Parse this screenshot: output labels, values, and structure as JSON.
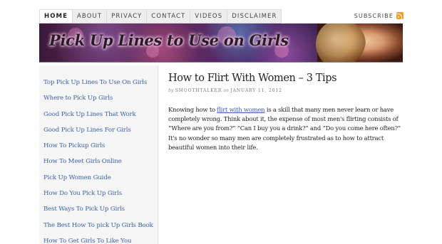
{
  "nav": {
    "items": [
      "HOME",
      "ABOUT",
      "PRIVACY",
      "CONTACT",
      "VIDEOS",
      "DISCLAIMER"
    ],
    "subscribe_label": "SUBSCRIBE"
  },
  "banner": {
    "title": "Pick Up Lines to Use on Girls"
  },
  "sidebar": {
    "links": [
      "Top Pick Up Lines To Use On Girls",
      "Where to Pick Up Girls",
      "Good Pick Up Lines That Work",
      "Good Pick Up Lines For Girls",
      "How To Pickup Girls",
      "How To Meet Girls Online",
      "Pick Up Women Guide",
      "How Do You Pick Up Girls",
      "Best Ways To Pick Up Girls",
      "The Best How To pick Up Girls Book",
      "How To Get Girls To Like You"
    ]
  },
  "post": {
    "title": "How to Flirt With Women – 3 Tips",
    "byline_by": "by",
    "author": "SMOOTHTALKER",
    "byline_on": "on",
    "date": "JANUARY 11, 2012",
    "para_part1": "Knowing how to ",
    "para_link": "flirt with women",
    "para_part2": " is a skill that many men never learn or have completely wrong. Think about it, the expense of most men's flirting consists of “Where are you from?” “Can I buy you a drink?” and “Do you come here often?” It's no wonder so many men are completely frustrated as to how to attract beautiful women into their life."
  },
  "colors": {
    "link": "#3a5fa8",
    "rss": "#f39c2c",
    "sidebar_bg": "#f6f6f6"
  }
}
